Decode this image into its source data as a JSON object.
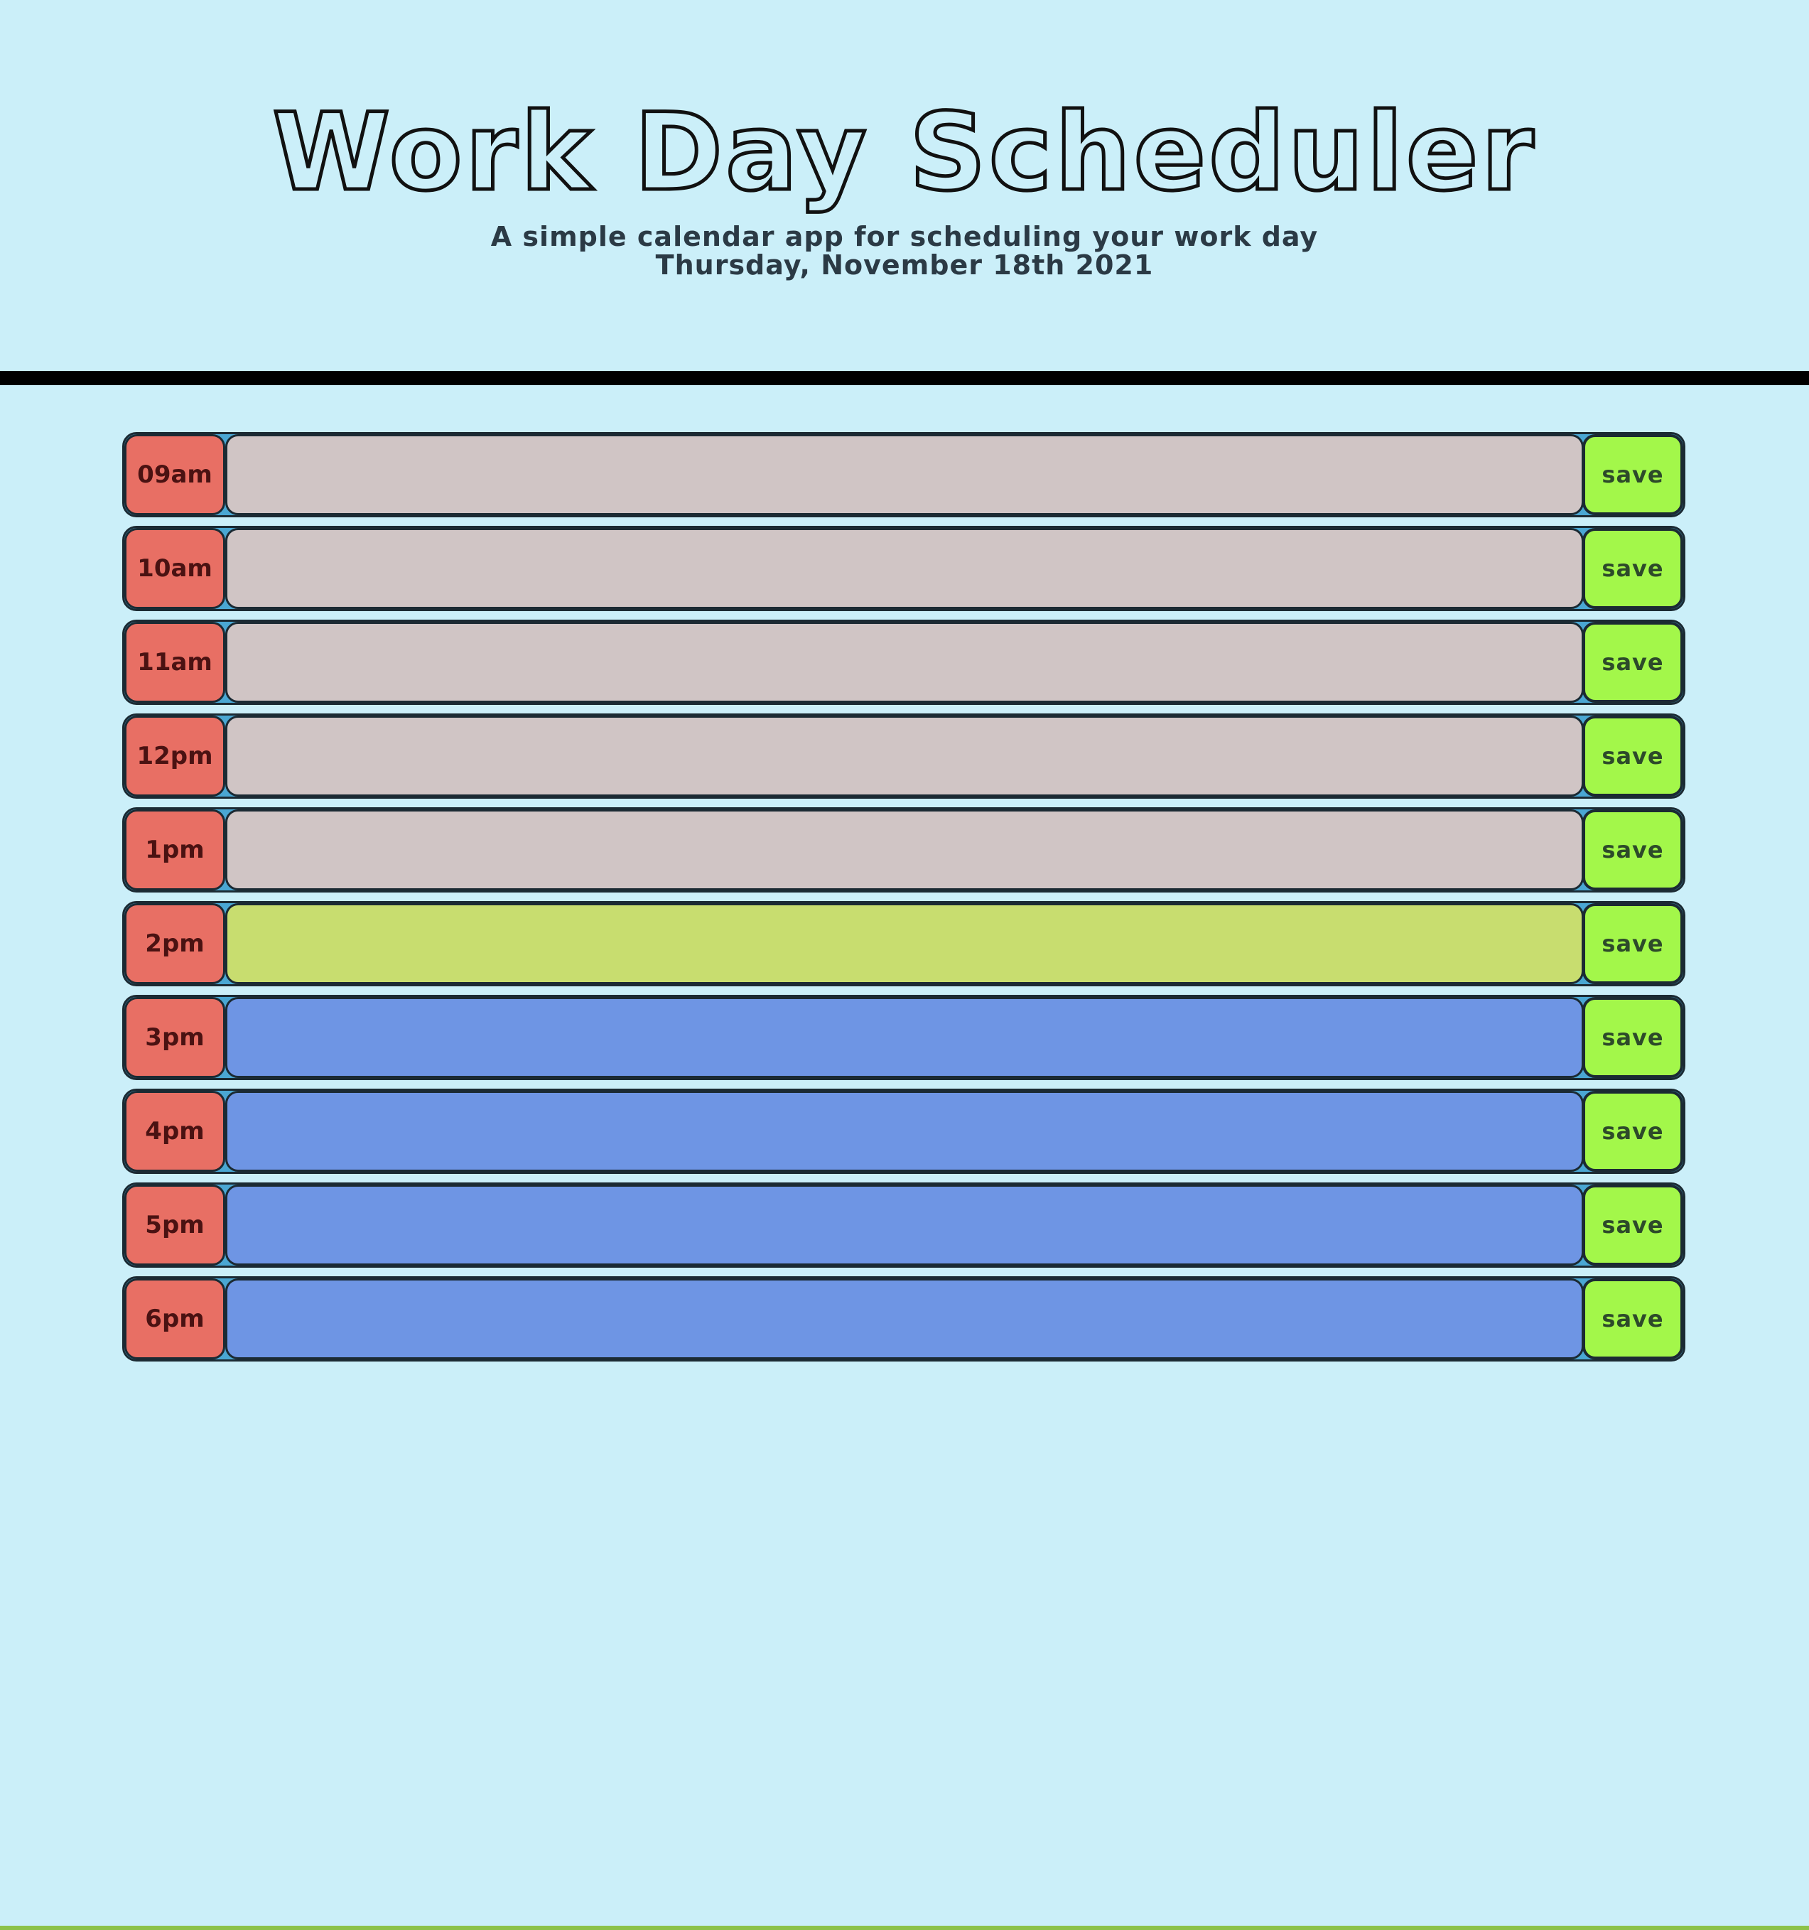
{
  "header": {
    "title": "Work Day Scheduler",
    "subtitle": "A simple calendar app for scheduling your work day",
    "date": "Thursday, November 18th 2021"
  },
  "colors": {
    "past": "#d0c5c5",
    "present": "#c8dd6f",
    "future": "#6e95e4",
    "hour": "#e86f64",
    "save": "#a3f74a",
    "background": "#cbeff9"
  },
  "schedule": {
    "save_label": "save",
    "rows": [
      {
        "hour": "09am",
        "state": "past",
        "text": ""
      },
      {
        "hour": "10am",
        "state": "past",
        "text": ""
      },
      {
        "hour": "11am",
        "state": "past",
        "text": ""
      },
      {
        "hour": "12pm",
        "state": "past",
        "text": ""
      },
      {
        "hour": "1pm",
        "state": "past",
        "text": ""
      },
      {
        "hour": "2pm",
        "state": "present",
        "text": ""
      },
      {
        "hour": "3pm",
        "state": "future",
        "text": ""
      },
      {
        "hour": "4pm",
        "state": "future",
        "text": ""
      },
      {
        "hour": "5pm",
        "state": "future",
        "text": ""
      },
      {
        "hour": "6pm",
        "state": "future",
        "text": ""
      }
    ]
  }
}
